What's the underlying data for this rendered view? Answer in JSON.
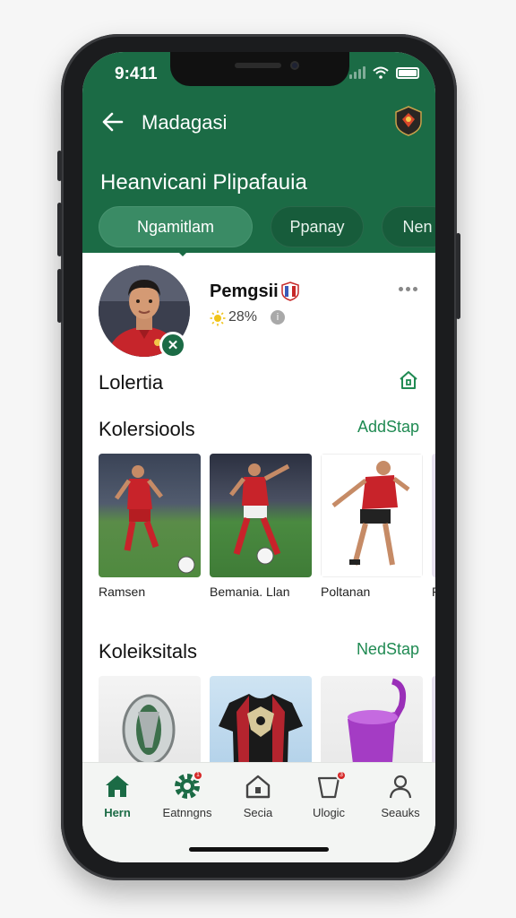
{
  "status": {
    "time": "9:411"
  },
  "header": {
    "app_title": "Madagasi",
    "page_title": "Heanvicani Plipafauia",
    "tabs": [
      {
        "label": "Ngamitlam",
        "active": true
      },
      {
        "label": "Ppanay",
        "active": false
      },
      {
        "label": "Nen",
        "active": false
      }
    ]
  },
  "profile": {
    "name": "Pemgsii",
    "rating": "28%",
    "info_icon": "i",
    "verify_icon": "✕"
  },
  "section": {
    "label": "Lolertia"
  },
  "collections": [
    {
      "title": "Kolersiools",
      "link": "AddStap",
      "items": [
        {
          "caption": "Ramsen"
        },
        {
          "caption": "Bemania. Llan"
        },
        {
          "caption": "Poltanan"
        },
        {
          "caption": "Ro"
        }
      ]
    },
    {
      "title": "Koleiksitals",
      "link": "NedStap",
      "items": [
        {
          "caption": ""
        },
        {
          "caption": ""
        },
        {
          "caption": ""
        },
        {
          "caption": ""
        }
      ]
    }
  ],
  "nav": [
    {
      "label": "Hern",
      "icon": "home-icon",
      "active": true
    },
    {
      "label": "Eatnngns",
      "icon": "gear-icon",
      "badge": "1"
    },
    {
      "label": "Secia",
      "icon": "house-outline-icon"
    },
    {
      "label": "Ulogic",
      "icon": "cup-icon",
      "badge": "3"
    },
    {
      "label": "Seauks",
      "icon": "user-icon"
    }
  ],
  "colors": {
    "brand": "#1b6b45",
    "link": "#1f8a52",
    "badge": "#d62828"
  }
}
